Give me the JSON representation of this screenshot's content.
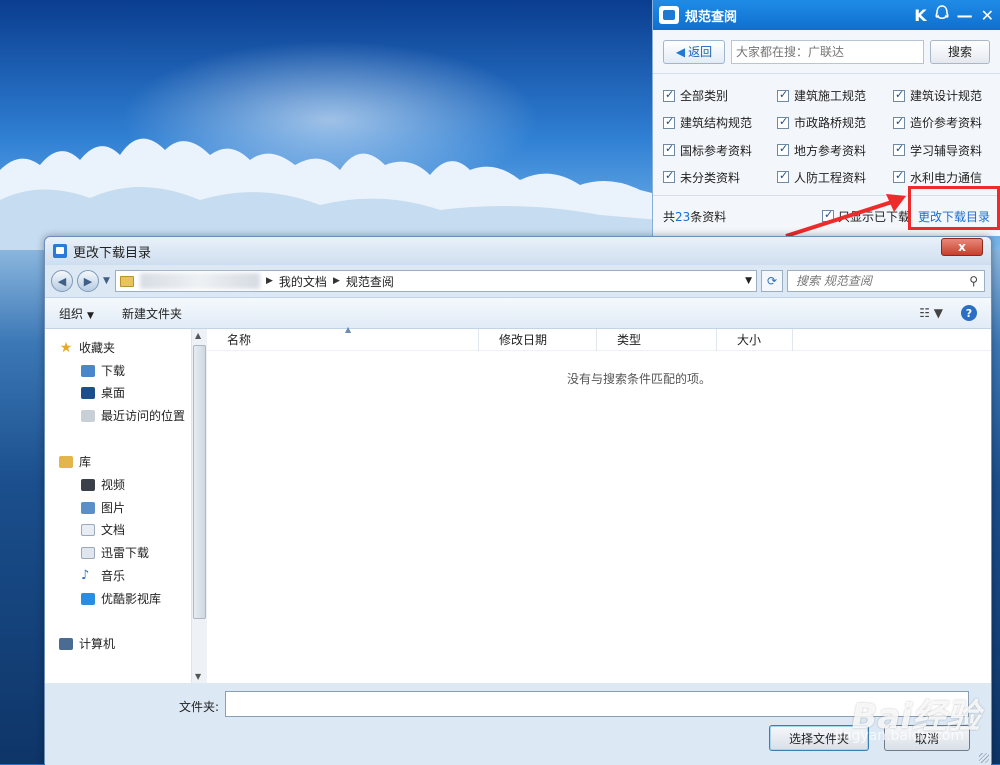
{
  "app": {
    "title": "规范查阅",
    "title_icons": [
      "k-logo-icon",
      "qq-icon",
      "minimize-icon",
      "close-icon"
    ],
    "back_label": "返回",
    "search_placeholder": "大家都在搜：广联达",
    "search_button": "搜索",
    "categories": [
      {
        "label": "全部类别",
        "checked": true
      },
      {
        "label": "建筑施工规范",
        "checked": true
      },
      {
        "label": "建筑设计规范",
        "checked": true
      },
      {
        "label": "建筑结构规范",
        "checked": true
      },
      {
        "label": "市政路桥规范",
        "checked": true
      },
      {
        "label": "造价参考资料",
        "checked": true
      },
      {
        "label": "国标参考资料",
        "checked": true
      },
      {
        "label": "地方参考资料",
        "checked": true
      },
      {
        "label": "学习辅导资料",
        "checked": true
      },
      {
        "label": "未分类资料",
        "checked": true
      },
      {
        "label": "人防工程资料",
        "checked": true
      },
      {
        "label": "水利电力通信",
        "checked": true
      }
    ],
    "count_prefix": "共",
    "count_value": "23",
    "count_suffix": "条资料",
    "only_downloaded": "只显示已下载",
    "change_dir": "更改下载目录"
  },
  "dialog": {
    "title": "更改下载目录",
    "close_label": "x",
    "breadcrumbs": [
      "我的文档",
      "规范查阅"
    ],
    "search_placeholder": "搜索 规范查阅",
    "toolbar": {
      "organize": "组织",
      "new_folder": "新建文件夹"
    },
    "nav": {
      "favorites": "收藏夹",
      "favorites_items": [
        "下载",
        "桌面",
        "最近访问的位置"
      ],
      "libraries": "库",
      "library_items": [
        "视频",
        "图片",
        "文档",
        "迅雷下载",
        "音乐",
        "优酷影视库"
      ],
      "computer": "计算机"
    },
    "columns": [
      "名称",
      "修改日期",
      "类型",
      "大小"
    ],
    "empty_message": "没有与搜索条件匹配的项。",
    "folder_label": "文件夹:",
    "folder_value": "",
    "select_button": "选择文件夹",
    "cancel_button": "取消"
  },
  "watermark": {
    "brand": "Bai经验",
    "url": "jingyan.baidu.com"
  },
  "colors": {
    "accent": "#1a6fd0",
    "highlight": "#ee2b2b",
    "titlebar": "#0f6fcf"
  }
}
